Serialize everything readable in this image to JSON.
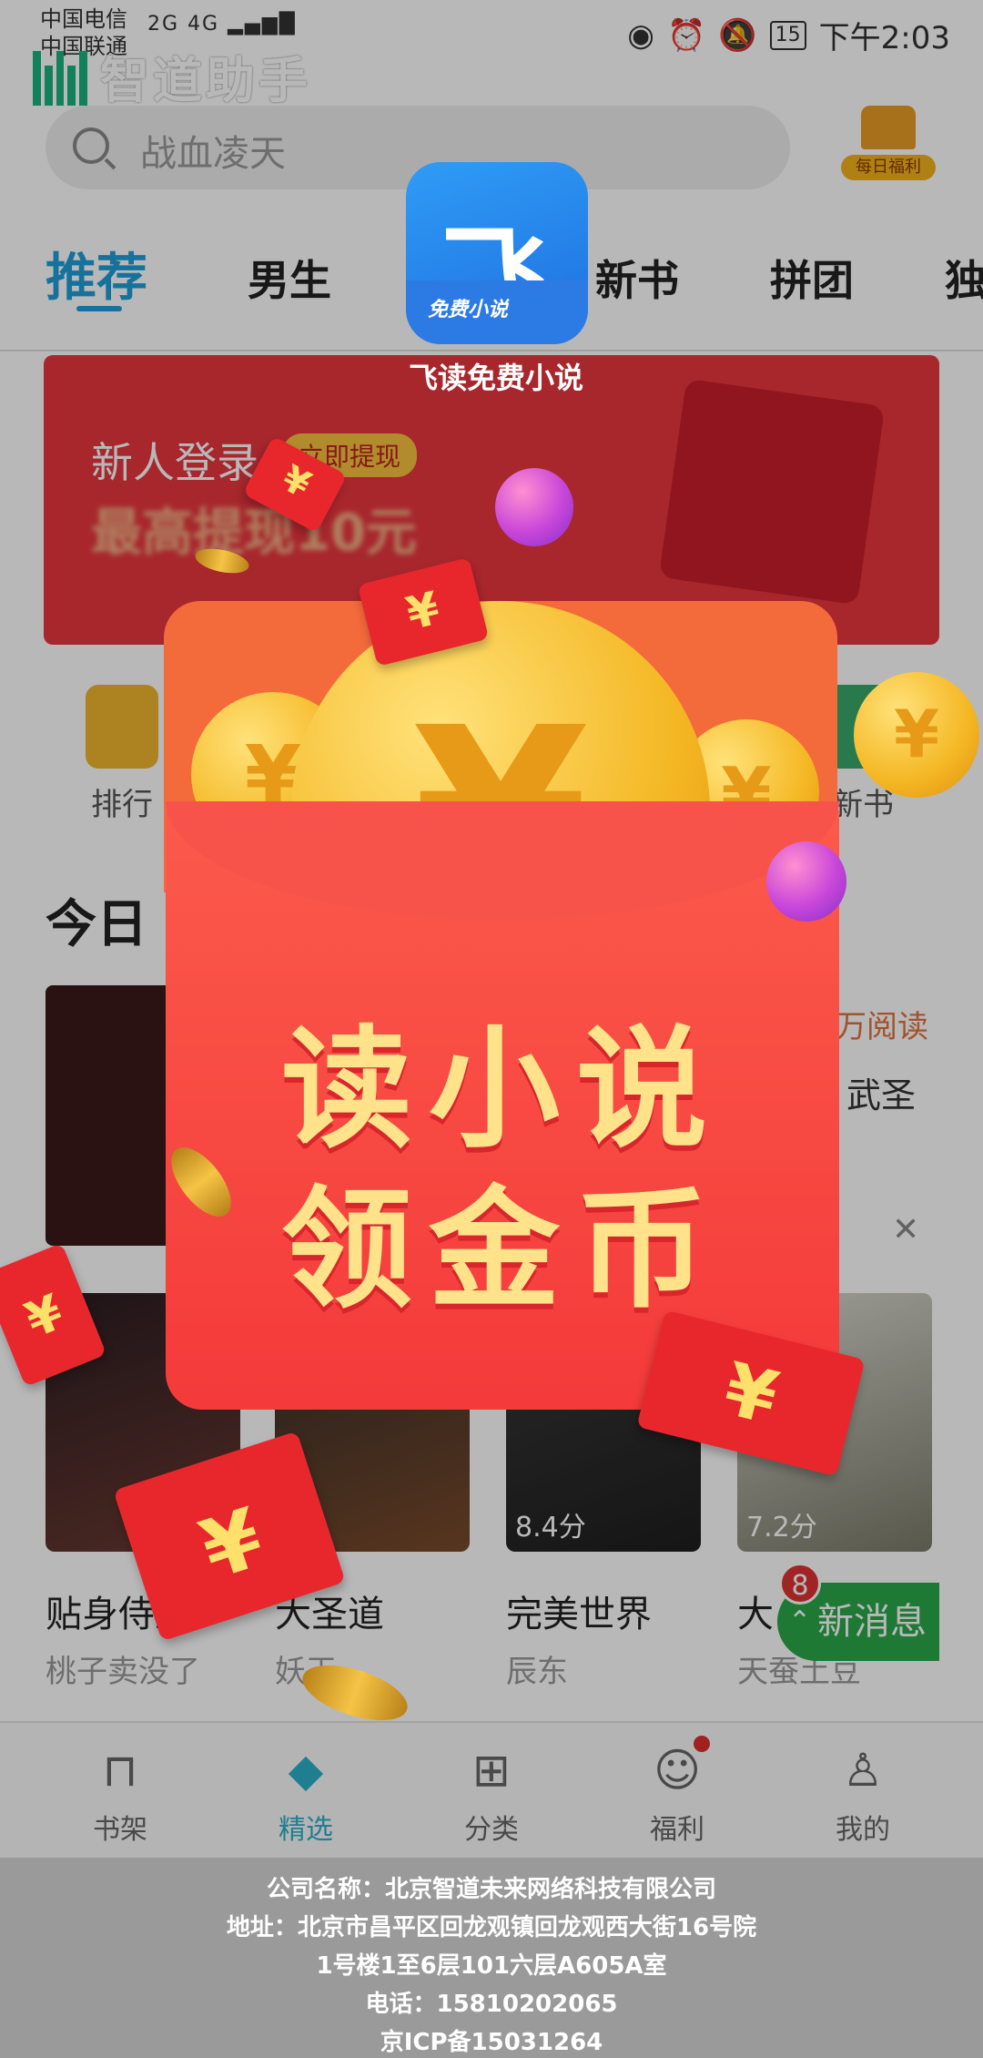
{
  "status_bar": {
    "carrier1": "中国电信",
    "carrier2": "中国联通",
    "signal": "2G 4G",
    "battery": "15",
    "time": "下午2:03"
  },
  "brand": {
    "name": "智道助手"
  },
  "search": {
    "text": "战血凌天"
  },
  "daily_bonus": {
    "label": "每日福利"
  },
  "tabs": [
    "推荐",
    "男生",
    "新书",
    "拼团",
    "独"
  ],
  "banner": {
    "title": "新人登录",
    "button": "立即提现",
    "subtitle": "最高提现10元"
  },
  "quick": {
    "left_label": "排行",
    "right_label": "新书"
  },
  "section": {
    "title": "今日"
  },
  "hot": {
    "reads": "万阅读",
    "author": "武圣"
  },
  "books": [
    {
      "title": "贴身侍卫",
      "author": "桃子卖没了",
      "score": ""
    },
    {
      "title": "大圣道",
      "author": "妖王",
      "score": "分"
    },
    {
      "title": "完美世界",
      "author": "辰东",
      "score": "8.4分"
    },
    {
      "title": "大",
      "author": "天蚕土豆",
      "score": "7.2分"
    }
  ],
  "new_message": {
    "label": "新消息",
    "count": "8"
  },
  "bottom_nav": [
    {
      "label": "书架",
      "icon": "bookshelf-icon",
      "glyph": "⊓"
    },
    {
      "label": "精选",
      "icon": "diamond-icon",
      "glyph": "◆"
    },
    {
      "label": "分类",
      "icon": "grid-icon",
      "glyph": "⊞"
    },
    {
      "label": "福利",
      "icon": "gift-icon",
      "glyph": "☺"
    },
    {
      "label": "我的",
      "icon": "user-icon",
      "glyph": "♙"
    }
  ],
  "app_badge": {
    "glyph": "飞",
    "tag": "免费小说",
    "name": "飞读免费小说"
  },
  "popup": {
    "line1": "读小说",
    "line2": "领金币",
    "coin_symbol": "¥"
  },
  "footer": {
    "line1": "公司名称：北京智道未来网络科技有限公司",
    "line2": "地址：北京市昌平区回龙观镇回龙观西大街16号院",
    "line3": "1号楼1至6层101六层A605A室",
    "line4": "电话：15810202065",
    "line5": "京ICP备15031264"
  },
  "colors": {
    "accent": "#1f9ed9",
    "envelope": "#f43a3a",
    "gold": "#ffe28a"
  }
}
